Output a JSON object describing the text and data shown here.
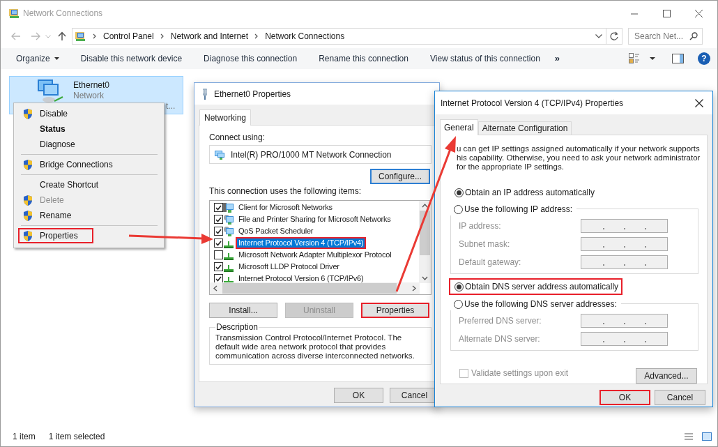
{
  "window": {
    "title": "Network Connections",
    "help_glyph": "?"
  },
  "address_bar": {
    "path": [
      "Control Panel",
      "Network and Internet",
      "Network Connections"
    ],
    "search_placeholder": "Search Net..."
  },
  "toolbar": {
    "items": [
      {
        "label": "Organize",
        "dropdown": true
      },
      {
        "label": "Disable this network device",
        "dropdown": false
      },
      {
        "label": "Diagnose this connection",
        "dropdown": false
      },
      {
        "label": "Rename this connection",
        "dropdown": false
      },
      {
        "label": "View status of this connection",
        "dropdown": false
      }
    ],
    "overflow": "»"
  },
  "connections": [
    {
      "name": "Ethernet0",
      "status": "Network",
      "detail": "t...",
      "selected": true
    }
  ],
  "context_menu": [
    {
      "kind": "item",
      "label": "Disable",
      "shield": true,
      "default": false,
      "disabled": false,
      "highlighted": false
    },
    {
      "kind": "item",
      "label": "Status",
      "shield": false,
      "default": true,
      "disabled": false,
      "highlighted": false
    },
    {
      "kind": "item",
      "label": "Diagnose",
      "shield": false,
      "default": false,
      "disabled": false,
      "highlighted": false
    },
    {
      "kind": "separator"
    },
    {
      "kind": "item",
      "label": "Bridge Connections",
      "shield": true,
      "default": false,
      "disabled": false,
      "highlighted": false
    },
    {
      "kind": "separator"
    },
    {
      "kind": "item",
      "label": "Create Shortcut",
      "shield": false,
      "default": false,
      "disabled": false,
      "highlighted": false
    },
    {
      "kind": "item",
      "label": "Delete",
      "shield": true,
      "default": false,
      "disabled": true,
      "highlighted": false
    },
    {
      "kind": "item",
      "label": "Rename",
      "shield": true,
      "default": false,
      "disabled": false,
      "highlighted": false
    },
    {
      "kind": "separator"
    },
    {
      "kind": "item",
      "label": "Properties",
      "shield": true,
      "default": false,
      "disabled": false,
      "highlighted": true
    }
  ],
  "status_bar": {
    "count": "1 item",
    "selection": "1 item selected"
  },
  "properties_dialog": {
    "title": "Ethernet0 Properties",
    "tabs": [
      {
        "label": "Networking",
        "selected": true
      }
    ],
    "connect_label": "Connect using:",
    "adapter": "Intel(R) PRO/1000 MT Network Connection",
    "configure": "Configure...",
    "items_label": "This connection uses the following items:",
    "items": [
      {
        "label": "Client for Microsoft Networks",
        "kind": "client",
        "checked": true,
        "selected": false,
        "highlighted": false
      },
      {
        "label": "File and Printer Sharing for Microsoft Networks",
        "kind": "service",
        "checked": true,
        "selected": false,
        "highlighted": false
      },
      {
        "label": "QoS Packet Scheduler",
        "kind": "service",
        "checked": true,
        "selected": false,
        "highlighted": false
      },
      {
        "label": "Internet Protocol Version 4 (TCP/IPv4)",
        "kind": "protocol",
        "checked": true,
        "selected": true,
        "highlighted": true
      },
      {
        "label": "Microsoft Network Adapter Multiplexor Protocol",
        "kind": "protocol",
        "checked": false,
        "selected": false,
        "highlighted": false
      },
      {
        "label": "Microsoft LLDP Protocol Driver",
        "kind": "protocol",
        "checked": true,
        "selected": false,
        "highlighted": false
      },
      {
        "label": "Internet Protocol Version 6 (TCP/IPv6)",
        "kind": "protocol",
        "checked": true,
        "selected": false,
        "highlighted": false
      }
    ],
    "buttons": [
      {
        "label": "Install...",
        "disabled": false,
        "highlighted": false
      },
      {
        "label": "Uninstall",
        "disabled": true,
        "highlighted": false
      },
      {
        "label": "Properties",
        "disabled": false,
        "highlighted": true
      }
    ],
    "description_title": "Description",
    "description": "Transmission Control Protocol/Internet Protocol. The default wide area network protocol that provides communication across diverse interconnected networks.",
    "footer_buttons": [
      "OK",
      "Cancel"
    ]
  },
  "ipv4_dialog": {
    "title": "Internet Protocol Version 4 (TCP/IPv4) Properties",
    "tabs": [
      {
        "label": "General",
        "selected": true
      },
      {
        "label": "Alternate Configuration",
        "selected": false
      }
    ],
    "intro": [
      "u can get IP settings assigned automatically if your network supports",
      "his capability. Otherwise, you need to ask your network administrator",
      "for the appropriate IP settings."
    ],
    "ip_options": [
      {
        "label": "Obtain an IP address automatically",
        "selected": true,
        "highlighted": false
      },
      {
        "label": "Use the following IP address:",
        "selected": false,
        "highlighted": false
      }
    ],
    "ip_fields": [
      {
        "label": "IP address:",
        "disabled": true
      },
      {
        "label": "Subnet mask:",
        "disabled": true
      },
      {
        "label": "Default gateway:",
        "disabled": true
      }
    ],
    "dns_options": [
      {
        "label": "Obtain DNS server address automatically",
        "selected": true,
        "highlighted": true
      },
      {
        "label": "Use the following DNS server addresses:",
        "selected": false,
        "highlighted": false
      }
    ],
    "dns_fields": [
      {
        "label": "Preferred DNS server:",
        "disabled": true
      },
      {
        "label": "Alternate DNS server:",
        "disabled": true
      }
    ],
    "validate": {
      "label": "Validate settings upon exit",
      "checked": false,
      "disabled": true
    },
    "advanced": "Advanced...",
    "buttons": [
      {
        "label": "OK",
        "highlighted": true
      },
      {
        "label": "Cancel",
        "highlighted": false
      }
    ]
  }
}
